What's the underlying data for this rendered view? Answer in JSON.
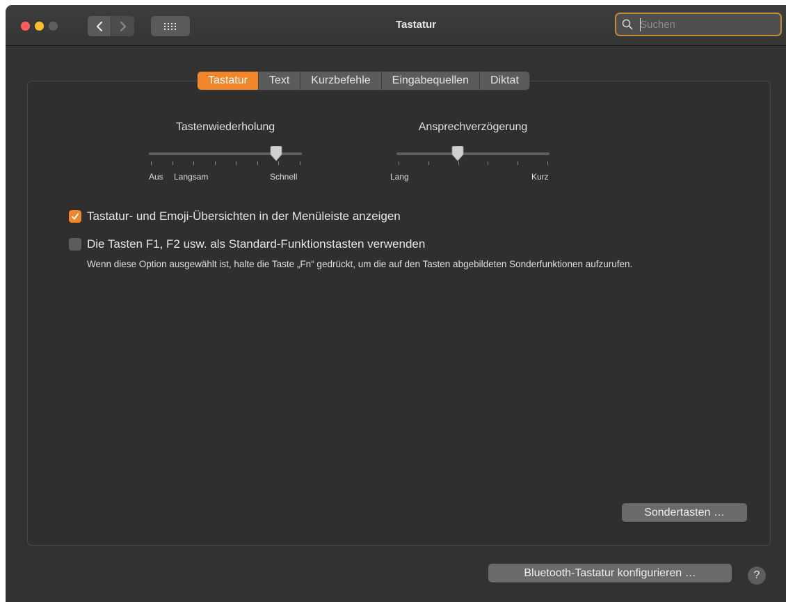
{
  "window": {
    "title": "Tastatur",
    "search": {
      "placeholder": "Suchen",
      "value": ""
    }
  },
  "tabs": [
    {
      "label": "Tastatur",
      "active": true
    },
    {
      "label": "Text",
      "active": false
    },
    {
      "label": "Kurzbefehle",
      "active": false
    },
    {
      "label": "Eingabequellen",
      "active": false
    },
    {
      "label": "Diktat",
      "active": false
    }
  ],
  "sliders": {
    "key_repeat": {
      "label": "Tastenwiederholung",
      "min_label": "Aus",
      "mid_label": "Langsam",
      "max_label": "Schnell",
      "tick_count": 8,
      "value_fraction": 0.83
    },
    "delay": {
      "label": "Ansprechverzögerung",
      "min_label": "Lang",
      "max_label": "Kurz",
      "tick_count": 6,
      "value_fraction": 0.4
    }
  },
  "checkboxes": {
    "show_viewers": {
      "label": "Tastatur- und Emoji-Übersichten in der Menüleiste anzeigen",
      "checked": true
    },
    "fn_keys": {
      "label": "Die Tasten F1, F2 usw. als Standard-Funktionstasten verwenden",
      "checked": false
    }
  },
  "fn_description": "Wenn diese Option ausgewählt ist, halte die Taste „Fn“ gedrückt, um die auf den Tasten abgebildeten Sonderfunktionen aufzurufen.",
  "buttons": {
    "modifier_keys": "Sondertasten …",
    "bluetooth": "Bluetooth-Tastatur konfigurieren …",
    "help": "?"
  },
  "colors": {
    "accent": "#f2862b",
    "window_bg": "#323232"
  }
}
